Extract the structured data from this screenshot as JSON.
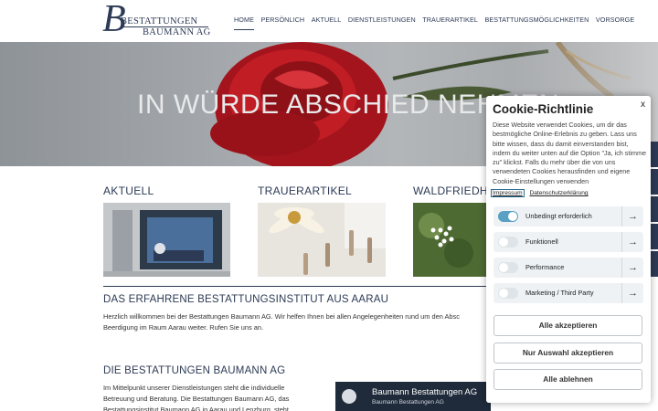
{
  "header": {
    "logo_line1": "BESTATTUNGEN",
    "logo_line2": "BAUMANN AG",
    "logo_letter": "B",
    "nav": [
      "HOME",
      "PERSÖNLICH",
      "AKTUELL",
      "DIENSTLEISTUNGEN",
      "TRAUERARTIKEL",
      "BESTATTUNGSMÖGLICHKEITEN",
      "VORSORGE"
    ]
  },
  "hero": {
    "title": "IN WÜRDE ABSCHIED NEHMEN"
  },
  "cards": [
    {
      "title": "AKTUELL"
    },
    {
      "title": "TRAUERARTIKEL"
    },
    {
      "title": "WALDFRIEDHO"
    }
  ],
  "section1": {
    "title": "DAS ERFAHRENE BESTATTUNGSINSTITUT AUS AARAU",
    "text": "Herzlich willkommen bei der Bestattungen Baumann AG. Wir helfen Ihnen bei allen Angelegenheiten rund um den Absc Beerdigung im Raum Aarau weiter. Rufen Sie uns an."
  },
  "section2": {
    "title": "DIE BESTATTUNGEN BAUMANN AG",
    "text": "Im Mittelpunkt unserer Dienstleistungen steht die individuelle Betreuung und Beratung. Die Bestattungen Baumann AG, das Bestattungsinstitut Baumann AG in Aarau und Lenzburg, steht"
  },
  "video": {
    "title": "Baumann Bestattungen AG",
    "subtitle": "Baumann Bestattungen AG"
  },
  "cookie": {
    "close": "x",
    "title": "Cookie-Richtlinie",
    "description": "Diese Website verwendet Cookies, um dir das bestmögliche Online-Erlebnis zu geben. Lass uns bitte wissen, dass du damit einverstanden bist, indem du weiter unten auf die Option \"Ja, ich stimme zu\" klickst. Falls du mehr über die von uns verwendeten Cookies herausfinden und eigene Cookie-Einstellungen verwenden",
    "link_impressum": "Impressum",
    "link_datenschutz": "Datenschutzerklärung",
    "options": [
      {
        "label": "Unbedingt erforderlich",
        "enabled": true
      },
      {
        "label": "Funktionell",
        "enabled": false
      },
      {
        "label": "Performance",
        "enabled": false
      },
      {
        "label": "Marketing / Third Party",
        "enabled": false
      }
    ],
    "arrow_glyph": "→",
    "btn_accept_all": "Alle akzeptieren",
    "btn_accept_selection": "Nur Auswahl akzeptieren",
    "btn_reject_all": "Alle ablehnen"
  },
  "colors": {
    "brand_navy": "#2c3a55",
    "toggle_on": "#5a9fc4"
  }
}
